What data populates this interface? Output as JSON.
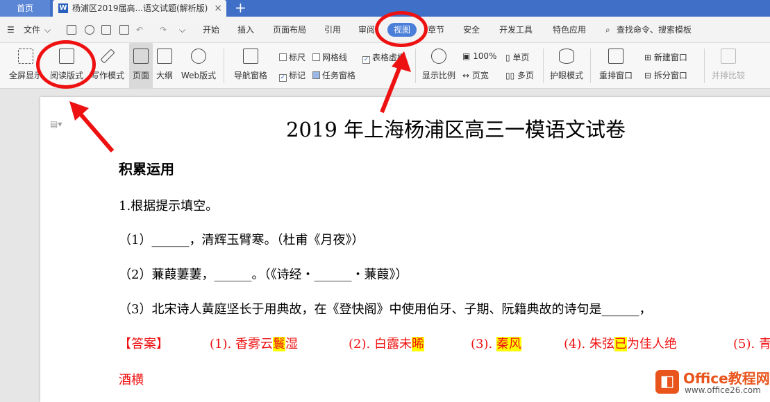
{
  "tabs": {
    "home": "首页",
    "document": "杨浦区2019届高...语文试题(解析版)",
    "close": "×",
    "add": "+"
  },
  "menu": {
    "file": "文件",
    "items": [
      "开始",
      "插入",
      "页面布局",
      "引用",
      "审阅",
      "视图",
      "章节",
      "安全",
      "开发工具",
      "特色应用"
    ],
    "search": "查找命令、搜索模板"
  },
  "ribbon": {
    "fullscreen": "全屏显示",
    "reading": "阅读版式",
    "writing": "写作模式",
    "page": "页面",
    "outline": "大纲",
    "web": "Web版式",
    "nav_pane": "导航窗格",
    "ruler": "标尺",
    "gridlines": "网格线",
    "table_lines": "表格虚框",
    "marks": "标记",
    "task_pane": "任务窗格",
    "zoom": "显示比例",
    "zoom100": "100%",
    "page_width": "页宽",
    "single": "单页",
    "multi": "多页",
    "eye": "护眼模式",
    "rearrange": "重排窗口",
    "new_window": "新建窗口",
    "split": "拆分窗口",
    "side_by_side": "并排比较"
  },
  "document": {
    "title": "2019 年上海杨浦区高三一模语文试卷",
    "heading": "积累运用",
    "q1": "1.根据提示填空。",
    "q1_1": "（1）______，清辉玉臂寒。（杜甫《月夜》）",
    "q1_2": "（2）蒹葭萋萋，______。（《诗经・______・蒹葭》）",
    "q1_3": "（3）北宋诗人黄庭坚长于用典故，在《登快阁》中使用伯牙、子期、阮籍典故的诗句是______，",
    "answer_label": "【答案】",
    "a1_pre": "(1).  香雾云",
    "a1_hl": "鬟",
    "a1_post": "湿",
    "a2_pre": "(2).  白露未",
    "a2_hl": "晞",
    "a3_pre": "(3).  ",
    "a3_hl": "秦风",
    "a4_pre": "(4).  朱弦",
    "a4_hl": "已",
    "a4_post": "为佳人绝",
    "a5_pre": "(5).  青",
    "last_line": "酒横"
  },
  "watermark": {
    "brand": "Office教程网",
    "url": "www.office26.com"
  },
  "colors": {
    "tab_bar": "#3f6fc6",
    "active_menu": "#4a7ed8",
    "answer_red": "#e11111",
    "highlight": "#ffff00",
    "annotation": "#ee1111"
  }
}
